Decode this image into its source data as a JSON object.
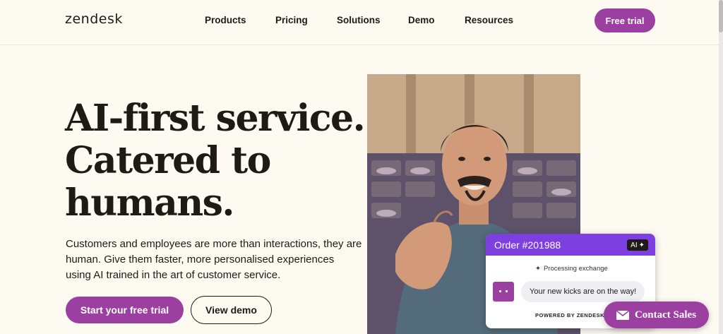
{
  "header": {
    "logo": "zendesk",
    "nav": [
      "Products",
      "Pricing",
      "Solutions",
      "Demo",
      "Resources"
    ],
    "cta": "Free trial"
  },
  "hero": {
    "headline_lines": [
      "AI-first service.",
      "Catered to",
      "humans."
    ],
    "lead": "Customers and employees are more than interactions, they are human. Give them faster, more personalised experiences using AI trained in the art of customer service.",
    "primary_cta": "Start your free trial",
    "secondary_cta": "View demo"
  },
  "order_card": {
    "title": "Order #201988",
    "badge": "AI",
    "status": "Processing exchange",
    "message": "Your new kicks are on the way!",
    "powered_by": "POWERED BY ZENDESK A"
  },
  "contact_sales": {
    "label": "Contact Sales",
    "icon": "mail-icon"
  },
  "colors": {
    "brand_purple": "#9b3fa0",
    "card_header": "#7d3fe0",
    "background": "#fdfaf1"
  }
}
